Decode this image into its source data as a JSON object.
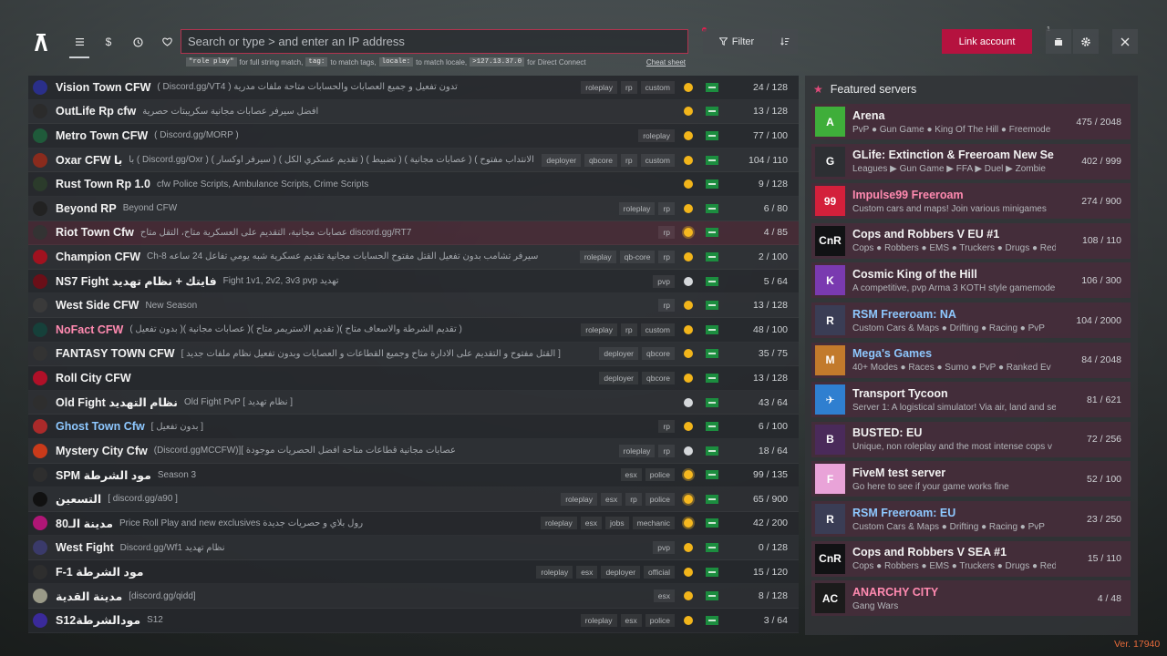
{
  "header": {
    "search_placeholder": "Search or type > and enter an IP address",
    "hints": {
      "code1": "\"role play\"",
      "text1": "for full string match,",
      "code2": "tag:",
      "text2": "to match tags,",
      "code3": "locale:",
      "text3": "to match locale,",
      "code4": ">127.13.37.0",
      "text4": "for Direct Connect",
      "cheat": "Cheat sheet"
    },
    "filter_label": "Filter",
    "link_account": "Link account",
    "notif_count": "1",
    "nav_icons": [
      "list-icon",
      "dollar-icon",
      "clock-icon",
      "heart-icon"
    ]
  },
  "servers": [
    {
      "name": "Vision Town CFW",
      "desc": "( Discord.gg/VT4 ) تدون تفعيل و جميع العصابات والحسابات متاحة ملفات مدرية",
      "tags": [
        "roleplay",
        "rp",
        "custom"
      ],
      "players": "24 / 128",
      "time": "sun"
    },
    {
      "name": "OutLife Rp cfw",
      "desc": "افضل سيرفر عصابات مجانية سكريبتات حصرية",
      "tags": [],
      "players": "13 / 128",
      "time": "sun"
    },
    {
      "name": "Metro Town CFW",
      "desc": "( Discord.gg/MORP )",
      "tags": [
        "roleplay"
      ],
      "players": "77 / 100",
      "time": "sun"
    },
    {
      "name": "Oxar CFW با",
      "desc": "با ( Discord.gg/Oxr ) ( سيرفر أوكسار ) ( تقديم عسكري الكل ) ( تضبيط ) ( عصابات مجانية ) ( الانتداب مفتوح )",
      "tags": [
        "deployer",
        "qbcore",
        "rp",
        "custom"
      ],
      "players": "104 / 110",
      "time": "sun"
    },
    {
      "name": "Rust Town Rp 1.0",
      "desc": "cfw Police Scripts, Ambulance Scripts, Crime Scripts",
      "tags": [],
      "players": "9 / 128",
      "time": "sun"
    },
    {
      "name": "Beyond RP",
      "desc": "Beyond CFW",
      "tags": [
        "roleplay",
        "rp"
      ],
      "players": "6 / 80",
      "time": "sun"
    },
    {
      "name": "Riot Town Cfw",
      "desc": "عصابات مجانية، التقديم على العسكرية متاح، التقل متاح discord.gg/RT7",
      "tags": [
        "rp"
      ],
      "players": "4 / 85",
      "time": "star"
    },
    {
      "name": "Champion CFW",
      "desc": "Ch-8 سيرفر تشامب بدون تفعيل القتل مفتوح الحسابات مجانية تقديم عسكرية شبه يومي تفاعل 24 ساعه",
      "tags": [
        "roleplay",
        "qb-core",
        "rp"
      ],
      "players": "2 / 100",
      "time": "sun"
    },
    {
      "name": "NS7 Fight فايتك + نظام تهديد",
      "desc": "Fight 1v1, 2v2, 3v3 pvp تهديد",
      "tags": [
        "pvp"
      ],
      "players": "5 / 64",
      "time": "moon"
    },
    {
      "name": "West Side CFW",
      "desc": "New Season",
      "tags": [
        "rp"
      ],
      "players": "13 / 128",
      "time": "sun"
    },
    {
      "name": "NoFact CFW",
      "desc": "( بدون تفعيل )( عصابات مجانية )( تقديم الاستريمر متاح )( تقديم الشرطة والاسعاف متاح )",
      "tags": [
        "roleplay",
        "rp",
        "custom"
      ],
      "players": "48 / 100",
      "time": "sun",
      "style": "pink"
    },
    {
      "name": "FANTASY TOWN CFW",
      "desc": "[ القتل مفتوح و التقديم على الادارة متاح وجميع القطاعات و العصابات وبدون تفعيل نظام ملفات جديد ]",
      "tags": [
        "deployer",
        "qbcore"
      ],
      "players": "35 / 75",
      "time": "sun"
    },
    {
      "name": "Roll City CFW",
      "desc": "",
      "tags": [
        "deployer",
        "qbcore"
      ],
      "players": "13 / 128",
      "time": "sun"
    },
    {
      "name": "Old Fight نظام التهديد",
      "desc": "Old Fight PvP [ نظام تهديد ]",
      "tags": [],
      "players": "43 / 64",
      "time": "moon"
    },
    {
      "name": "Ghost Town Cfw",
      "desc": "[ بدون تفعيل ]",
      "tags": [
        "rp"
      ],
      "players": "6 / 100",
      "time": "sun",
      "style": "blue"
    },
    {
      "name": "Mystery City Cfw",
      "desc": "(Discord.ggMCCFW)][ عصابات مجانية قطاعات متاحة افضل الحصريات موجودة",
      "tags": [
        "roleplay",
        "rp"
      ],
      "players": "18 / 64",
      "time": "moon"
    },
    {
      "name": "SPM مود الشرطة",
      "desc": "Season 3",
      "tags": [
        "esx",
        "police"
      ],
      "players": "99 / 135",
      "time": "star"
    },
    {
      "name": "التسعين",
      "desc": "[ discord.gg/a90 ]",
      "tags": [
        "roleplay",
        "esx",
        "rp",
        "police"
      ],
      "players": "65 / 900",
      "time": "star"
    },
    {
      "name": "مدينة الـ80",
      "desc": "Price Roll Play and new exclusives رول بلاي و حصريات جديدة",
      "tags": [
        "roleplay",
        "esx",
        "jobs",
        "mechanic"
      ],
      "players": "42 / 200",
      "time": "star"
    },
    {
      "name": "West Fight",
      "desc": "Discord.gg/Wf1 نظام تهديد",
      "tags": [
        "pvp"
      ],
      "players": "0 / 128",
      "time": "sun"
    },
    {
      "name": "F-1 مود الشرطة",
      "desc": "",
      "tags": [
        "roleplay",
        "esx",
        "deployer",
        "official"
      ],
      "players": "15 / 120",
      "time": "sun"
    },
    {
      "name": "مدينة القدية",
      "desc": "[discord.gg/qidd]",
      "tags": [
        "esx"
      ],
      "players": "8 / 128",
      "time": "sun"
    },
    {
      "name": "S12مودالشرطة",
      "desc": "S12",
      "tags": [
        "roleplay",
        "esx",
        "police"
      ],
      "players": "3 / 64",
      "time": "sun"
    }
  ],
  "featured": {
    "title": "Featured servers",
    "items": [
      {
        "title": "Arena",
        "sub": "PvP ● Gun Game ● King Of The Hill ● Freemode",
        "count": "475 / 2048",
        "logo": "A",
        "color": "#3fae3a"
      },
      {
        "title": "GLife: Extinction & Freeroam New Se",
        "sub": "Leagues ▶ Gun Game ▶ FFA ▶ Duel ▶ Zombie",
        "count": "402 / 999",
        "logo": "G",
        "color": "#2d2f33"
      },
      {
        "title": "Impulse99 Freeroam",
        "sub": "Custom cars and maps! Join various minigames",
        "count": "274 / 900",
        "logo": "99",
        "color": "#d3203b",
        "style": "pink"
      },
      {
        "title": "Cops and Robbers V EU #1",
        "sub": "Cops ● Robbers ● EMS ● Truckers ● Drugs ● Red",
        "count": "108 / 110",
        "logo": "CnR",
        "color": "#111214"
      },
      {
        "title": "Cosmic King of the Hill",
        "sub": "A competitive, pvp Arma 3 KOTH style gamemode",
        "count": "106 / 300",
        "logo": "K",
        "color": "#7a3ab0"
      },
      {
        "title": "RSM Freeroam: NA",
        "sub": "Custom Cars & Maps ● Drifting ● Racing ● PvP",
        "count": "104 / 2000",
        "logo": "R",
        "color": "#3a3d55",
        "style": "blue"
      },
      {
        "title": "Mega's Games",
        "sub": "40+ Modes ● Races ● Sumo ● PvP ● Ranked Ev",
        "count": "84 / 2048",
        "logo": "M",
        "color": "#c27a2c",
        "style": "blue"
      },
      {
        "title": "Transport Tycoon",
        "sub": "Server 1: A logistical simulator! Via air, land and se",
        "count": "81 / 621",
        "logo": "✈",
        "color": "#2f7fd0"
      },
      {
        "title": "BUSTED: EU",
        "sub": "Unique, non roleplay and the most intense cops v",
        "count": "72 / 256",
        "logo": "B",
        "color": "#4a2a5a"
      },
      {
        "title": "FiveM test server",
        "sub": "Go here to see if your game works fine",
        "count": "52 / 100",
        "logo": "F",
        "color": "#e9a3d8"
      },
      {
        "title": "RSM Freeroam: EU",
        "sub": "Custom Cars & Maps ● Drifting ● Racing ● PvP",
        "count": "23 / 250",
        "logo": "R",
        "color": "#3a3d55",
        "style": "blue"
      },
      {
        "title": "Cops and Robbers V SEA #1",
        "sub": "Cops ● Robbers ● EMS ● Truckers ● Drugs ● Redz",
        "count": "15 / 110",
        "logo": "CnR",
        "color": "#111214"
      },
      {
        "title": "ANARCHY CITY",
        "sub": "Gang Wars",
        "count": "4 / 48",
        "logo": "AC",
        "color": "#1b1b1b",
        "style": "pink"
      }
    ]
  },
  "version": "Ver. 17940"
}
